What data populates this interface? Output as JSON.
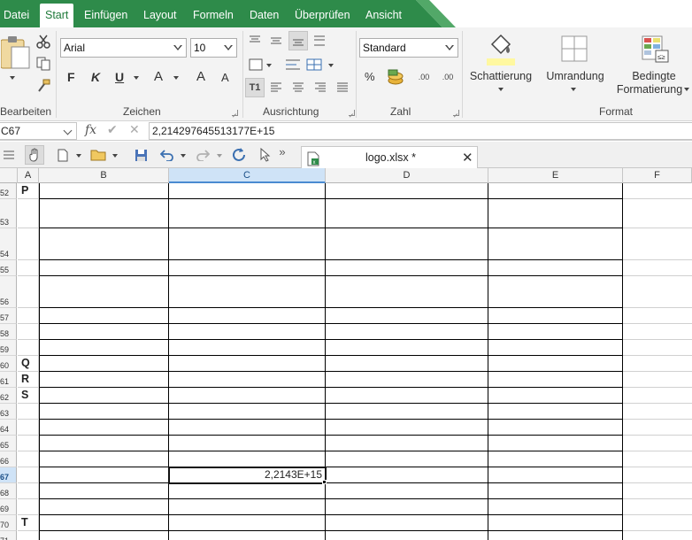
{
  "menu": {
    "items": [
      "Datei",
      "Start",
      "Einfügen",
      "Layout",
      "Formeln",
      "Daten",
      "Überprüfen",
      "Ansicht"
    ],
    "active": "Start",
    "accent": "#2e8b4a"
  },
  "ribbon": {
    "groups": {
      "bearbeiten": "Bearbeiten",
      "zeichen": "Zeichen",
      "ausrichtung": "Ausrichtung",
      "zahl": "Zahl",
      "format": "Format"
    },
    "font_name": "Arial",
    "font_size": "10",
    "number_format": "Standard",
    "bold": "F",
    "italic": "K",
    "underline": "U",
    "font_color_letter": "A",
    "grow_font": "A",
    "shrink_font": "A",
    "percent": "%",
    "dec_increase": ".00",
    "dec_decrease": ".00",
    "shading_label": "Schattierung",
    "border_label": "Umrandung",
    "cond_format_line1": "Bedingte",
    "cond_format_line2": "Formatierung"
  },
  "formula_bar": {
    "name_box": "C67",
    "fx": "fx",
    "value": "2,214297645513177E+15"
  },
  "toolbar": {
    "document_tab": "logo.xlsx *",
    "more": "»"
  },
  "grid": {
    "columns": [
      "A",
      "B",
      "C",
      "D",
      "E",
      "F"
    ],
    "selected_column": "C",
    "rows": [
      {
        "num": "52",
        "a": "P"
      },
      {
        "num": "53",
        "a": ""
      },
      {
        "num": "54",
        "a": ""
      },
      {
        "num": "55",
        "a": ""
      },
      {
        "num": "56",
        "a": ""
      },
      {
        "num": "57",
        "a": ""
      },
      {
        "num": "58",
        "a": ""
      },
      {
        "num": "59",
        "a": ""
      },
      {
        "num": "60",
        "a": "Q"
      },
      {
        "num": "61",
        "a": "R"
      },
      {
        "num": "62",
        "a": "S"
      },
      {
        "num": "63",
        "a": ""
      },
      {
        "num": "64",
        "a": ""
      },
      {
        "num": "65",
        "a": ""
      },
      {
        "num": "66",
        "a": ""
      },
      {
        "num": "67",
        "a": "",
        "c": "2,2143E+15",
        "selected": true
      },
      {
        "num": "68",
        "a": ""
      },
      {
        "num": "69",
        "a": ""
      },
      {
        "num": "70",
        "a": "T"
      },
      {
        "num": "71",
        "a": ""
      }
    ]
  }
}
